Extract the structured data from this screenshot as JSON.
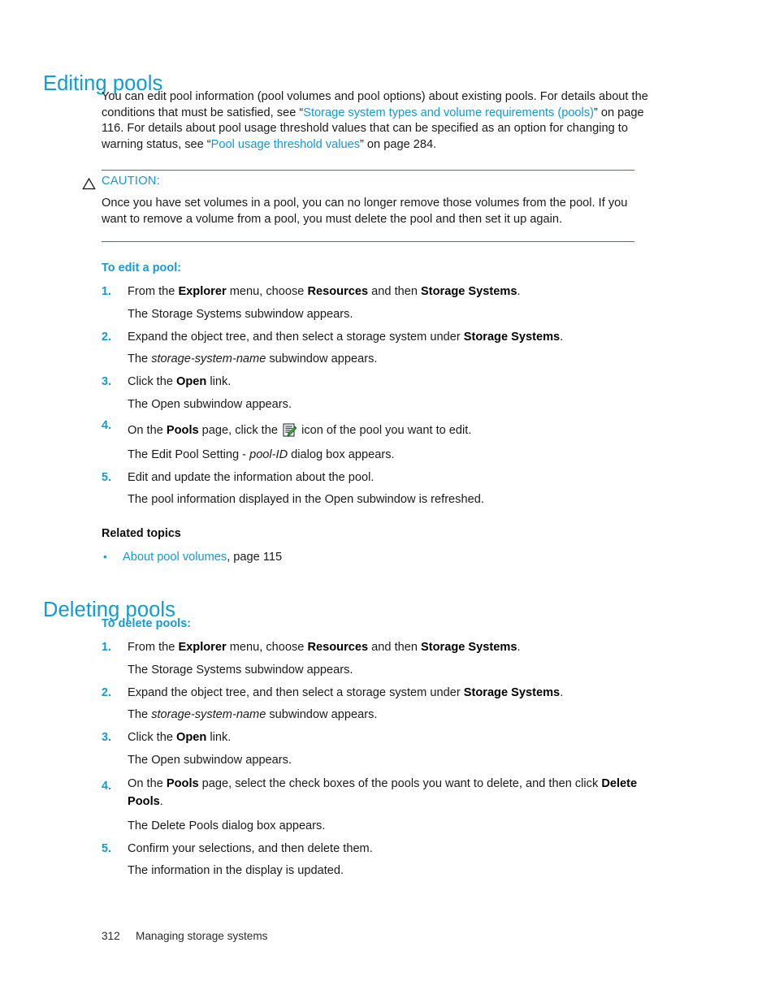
{
  "document": {
    "colors": {
      "heading_blue": "#0c9cd8",
      "link_blue": "#0f9ad6",
      "rule_blue": "#1683c0",
      "body_text": "#1a1a1a"
    }
  },
  "section_editing": {
    "heading": "Editing pools",
    "intro": {
      "part1": "You can edit pool information (pool volumes and pool options) about existing pools. For details about the conditions that must be satisfied, see “",
      "link1": "Storage system types and volume requirements (pools)",
      "part2": "” on page 116. For details about pool usage threshold values that can be specified as an option for changing to warning status, see “",
      "link2": "Pool usage threshold values",
      "part3": "” on page 284."
    },
    "caution": {
      "icon": "warning-triangle-icon",
      "label": "CAUTION:",
      "text": "Once you have set volumes in a pool, you can no longer remove those volumes from the pool. If you want to remove a volume from a pool, you must delete the pool and then set it up again."
    },
    "procedure_heading": "To edit a pool:",
    "steps": [
      {
        "number": "1.",
        "text_a": "From the ",
        "bold_a": "Explorer",
        "text_b": " menu, choose ",
        "bold_b": "Resources",
        "text_c": " and then ",
        "bold_c": "Storage Systems",
        "text_d": ".",
        "result": "The Storage Systems subwindow appears."
      },
      {
        "number": "2.",
        "text_a": "Expand the object tree, and then select a storage system under ",
        "bold_a": "Storage Systems",
        "text_b": ".",
        "result_a": "The ",
        "result_italic": "storage-system-name",
        "result_b": " subwindow appears."
      },
      {
        "number": "3.",
        "text_a": "Click the ",
        "bold_a": "Open",
        "text_b": " link.",
        "result": "The Open subwindow appears."
      },
      {
        "number": "4.",
        "text_a": "On the ",
        "bold_a": "Pools",
        "text_b": " page, click the ",
        "icon": "edit-pool-icon",
        "text_c": " icon of the pool you want to edit.",
        "result_a": "The Edit Pool Setting - ",
        "result_italic": "pool-ID",
        "result_b": " dialog box appears."
      },
      {
        "number": "5.",
        "text_a": "Edit and update the information about the pool.",
        "result": "The pool information displayed in the Open subwindow is refreshed."
      }
    ],
    "related_heading": "Related topics",
    "related_items": [
      {
        "bullet": "•",
        "link": "About pool volumes",
        "suffix": ", page 115"
      }
    ]
  },
  "section_deleting": {
    "heading": "Deleting pools",
    "procedure_heading": "To delete pools:",
    "steps": [
      {
        "number": "1.",
        "text_a": "From the ",
        "bold_a": "Explorer",
        "text_b": " menu, choose ",
        "bold_b": "Resources",
        "text_c": " and then ",
        "bold_c": "Storage Systems",
        "text_d": ".",
        "result": "The Storage Systems subwindow appears."
      },
      {
        "number": "2.",
        "text_a": "Expand the object tree, and then select a storage system under ",
        "bold_a": "Storage Systems",
        "text_b": ".",
        "result_a": "The ",
        "result_italic": "storage-system-name",
        "result_b": " subwindow appears."
      },
      {
        "number": "3.",
        "text_a": "Click the ",
        "bold_a": "Open",
        "text_b": " link.",
        "result": "The Open subwindow appears."
      },
      {
        "number": "4.",
        "text_a": "On the ",
        "bold_a": "Pools",
        "text_b": " page, select the check boxes of the pools you want to delete, and then click ",
        "bold_b": "Delete Pools",
        "text_c": ".",
        "result": "The Delete Pools dialog box appears."
      },
      {
        "number": "5.",
        "text_a": "Confirm your selections, and then delete them.",
        "result": "The information in the display is updated."
      }
    ]
  },
  "footer": {
    "page_number": "312",
    "chapter_title": "Managing storage systems"
  }
}
